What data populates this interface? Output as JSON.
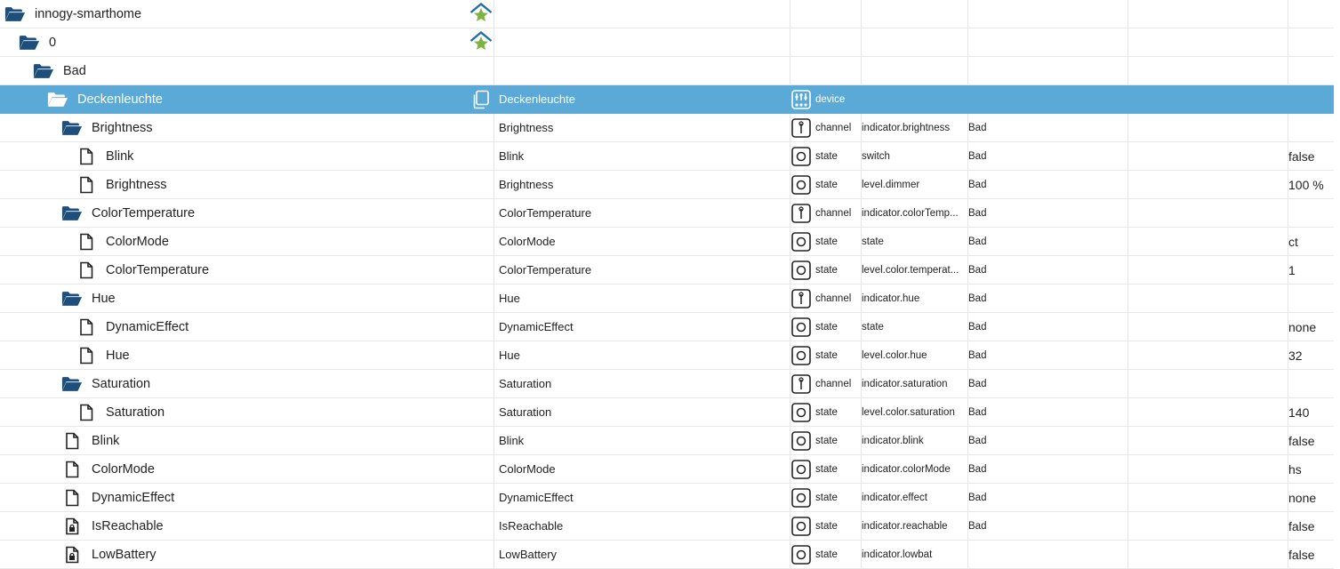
{
  "colors": {
    "folder": "#1f4e79",
    "selected_row": "#5aa9d6",
    "admin_house": "#1f6fa8",
    "admin_star": "#7cb342"
  },
  "rows": [
    {
      "level": 0,
      "icon": "folder-open-icon",
      "label": "innogy-smarthome",
      "admin": true
    },
    {
      "level": 1,
      "icon": "folder-open-icon",
      "label": "0",
      "admin": true
    },
    {
      "level": 2,
      "icon": "folder-open-icon",
      "label": "Bad"
    },
    {
      "level": 3,
      "icon": "folder-open-icon",
      "label": "Deckenleuchte",
      "selected": true,
      "alias": true,
      "name": "Deckenleuchte",
      "type_icon": "device-icon",
      "type": "device"
    },
    {
      "level": 4,
      "icon": "folder-open-icon",
      "label": "Brightness",
      "name": "Brightness",
      "type_icon": "channel-icon",
      "type": "channel",
      "role": "indicator.brightness",
      "room": "Bad"
    },
    {
      "level": 5,
      "icon": "file-icon",
      "label": "Blink",
      "name": "Blink",
      "type_icon": "state-icon",
      "type": "state",
      "role": "switch",
      "room": "Bad",
      "value": "false"
    },
    {
      "level": 5,
      "icon": "file-icon",
      "label": "Brightness",
      "name": "Brightness",
      "type_icon": "state-icon",
      "type": "state",
      "role": "level.dimmer",
      "room": "Bad",
      "value": "100 %"
    },
    {
      "level": 4,
      "icon": "folder-open-icon",
      "label": "ColorTemperature",
      "name": "ColorTemperature",
      "type_icon": "channel-icon",
      "type": "channel",
      "role": "indicator.colorTemp...",
      "room": "Bad"
    },
    {
      "level": 5,
      "icon": "file-icon",
      "label": "ColorMode",
      "name": "ColorMode",
      "type_icon": "state-icon",
      "type": "state",
      "role": "state",
      "room": "Bad",
      "value": "ct"
    },
    {
      "level": 5,
      "icon": "file-icon",
      "label": "ColorTemperature",
      "name": "ColorTemperature",
      "type_icon": "state-icon",
      "type": "state",
      "role": "level.color.temperat...",
      "room": "Bad",
      "value": "1"
    },
    {
      "level": 4,
      "icon": "folder-open-icon",
      "label": "Hue",
      "name": "Hue",
      "type_icon": "channel-icon",
      "type": "channel",
      "role": "indicator.hue",
      "room": "Bad"
    },
    {
      "level": 5,
      "icon": "file-icon",
      "label": "DynamicEffect",
      "name": "DynamicEffect",
      "type_icon": "state-icon",
      "type": "state",
      "role": "state",
      "room": "Bad",
      "value": "none"
    },
    {
      "level": 5,
      "icon": "file-icon",
      "label": "Hue",
      "name": "Hue",
      "type_icon": "state-icon",
      "type": "state",
      "role": "level.color.hue",
      "room": "Bad",
      "value": "32"
    },
    {
      "level": 4,
      "icon": "folder-open-icon",
      "label": "Saturation",
      "name": "Saturation",
      "type_icon": "channel-icon",
      "type": "channel",
      "role": "indicator.saturation",
      "room": "Bad"
    },
    {
      "level": 5,
      "icon": "file-icon",
      "label": "Saturation",
      "name": "Saturation",
      "type_icon": "state-icon",
      "type": "state",
      "role": "level.color.saturation",
      "room": "Bad",
      "value": "140"
    },
    {
      "level": 4,
      "icon": "file-icon",
      "label": "Blink",
      "name": "Blink",
      "type_icon": "state-icon",
      "type": "state",
      "role": "indicator.blink",
      "room": "Bad",
      "value": "false"
    },
    {
      "level": 4,
      "icon": "file-icon",
      "label": "ColorMode",
      "name": "ColorMode",
      "type_icon": "state-icon",
      "type": "state",
      "role": "indicator.colorMode",
      "room": "Bad",
      "value": "hs"
    },
    {
      "level": 4,
      "icon": "file-icon",
      "label": "DynamicEffect",
      "name": "DynamicEffect",
      "type_icon": "state-icon",
      "type": "state",
      "role": "indicator.effect",
      "room": "Bad",
      "value": "none"
    },
    {
      "level": 4,
      "icon": "file-lock-icon",
      "label": "IsReachable",
      "name": "IsReachable",
      "type_icon": "state-icon",
      "type": "state",
      "role": "indicator.reachable",
      "room": "Bad",
      "value": "false"
    },
    {
      "level": 4,
      "icon": "file-lock-icon",
      "label": "LowBattery",
      "name": "LowBattery",
      "type_icon": "state-icon",
      "type": "state",
      "role": "indicator.lowbat",
      "value": "false"
    }
  ]
}
